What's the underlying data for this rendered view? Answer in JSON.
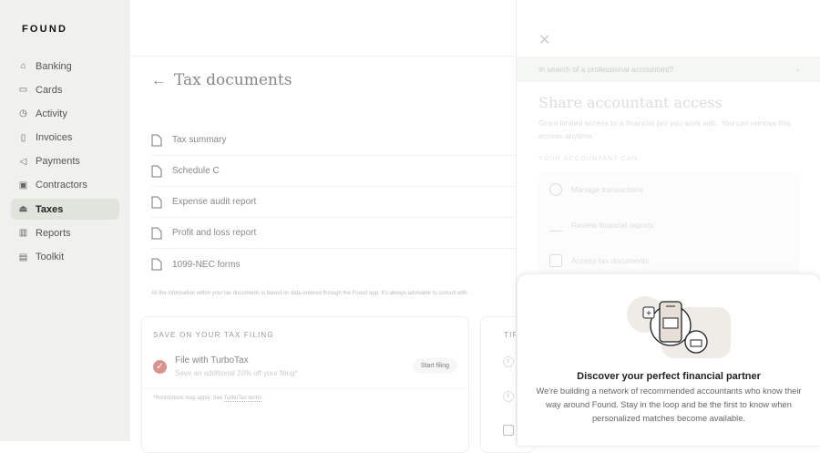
{
  "brand": "FOUND",
  "sidebar": {
    "items": [
      {
        "label": "Banking",
        "icon": "bank-icon"
      },
      {
        "label": "Cards",
        "icon": "card-icon"
      },
      {
        "label": "Activity",
        "icon": "clock-icon"
      },
      {
        "label": "Invoices",
        "icon": "invoice-icon"
      },
      {
        "label": "Payments",
        "icon": "send-icon"
      },
      {
        "label": "Contractors",
        "icon": "contractor-icon"
      },
      {
        "label": "Taxes",
        "icon": "taxes-icon",
        "active": true
      },
      {
        "label": "Reports",
        "icon": "chart-icon"
      },
      {
        "label": "Toolkit",
        "icon": "toolkit-icon"
      }
    ]
  },
  "main": {
    "title": "Tax documents",
    "documents": [
      "Tax summary",
      "Schedule C",
      "Expense audit report",
      "Profit and loss report",
      "1099-NEC forms"
    ],
    "disclaimer": "All the information within your tax documents is based on data entered through the Found app. It's always advisable to consult with",
    "save_card": {
      "label": "SAVE ON YOUR TAX FILING",
      "title": "File with TurboTax",
      "subtitle": "Save an additional 20% off your filing*",
      "button": "Start filing",
      "footnote_prefix": "*Restrictions may apply. See ",
      "footnote_link": "TurboTax terms",
      "footnote_suffix": "."
    },
    "tips_card": {
      "label": "TIPS"
    }
  },
  "panel": {
    "banner": "In search of a professional accountant?",
    "title": "Share accountant access",
    "description": "Grant limited access to a financial pro you work with. You can remove this access anytime.",
    "label": "YOUR ACCOUNTANT CAN",
    "permissions": [
      "Manage transactions",
      "Review financial reports",
      "Access tax documents"
    ],
    "sheet": {
      "title": "Discover your perfect financial partner",
      "body": "We're building a network of recommended accountants who know their way around Found. Stay in the loop and be the first to know when personalized matches become available."
    }
  },
  "colors": {
    "sidebar_bg": "#f0f1ee",
    "active_bg": "#e1e4dc",
    "check": "#d7938c"
  }
}
